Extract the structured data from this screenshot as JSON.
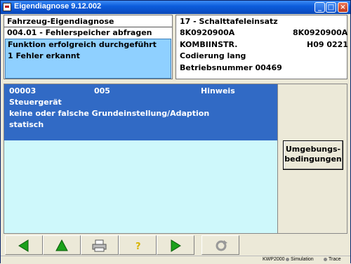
{
  "window": {
    "title": "Eigendiagnose 9.12.002"
  },
  "left": {
    "line1": "Fahrzeug-Eigendiagnose",
    "line2": "004.01 - Fehlerspeicher abfragen",
    "status1": "Funktion erfolgreich durchgeführt",
    "status2": "1 Fehler erkannt"
  },
  "right": {
    "title": "17 - Schalttafeleinsatz",
    "part_left": "8K0920900A",
    "part_right": "8K0920900A",
    "component": "KOMBIINSTR.",
    "version": "H09  0221",
    "coding": "Codierung lang",
    "workshop": "Betriebsnummer 00469"
  },
  "fault": {
    "code": "00003",
    "type": "005",
    "kind": "Hinweis",
    "desc1": "Steuergerät",
    "desc2": "keine oder falsche Grundeinstellung/Adaption",
    "desc3": "statisch"
  },
  "side": {
    "button_line1": "Umgebungs-",
    "button_line2": "bedingungen"
  },
  "statusbar": {
    "protocol": "KWP2000",
    "simulation": "Simulation",
    "trace": "Trace"
  }
}
